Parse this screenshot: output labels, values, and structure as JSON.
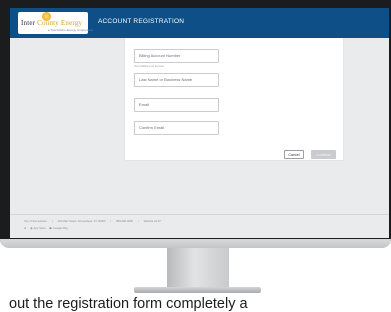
{
  "app": {
    "logo_text_a": "Inter",
    "logo_text_b": "County Energy",
    "logo_tagline": "a Touchstone Energy Cooperative",
    "header_title": "ACCOUNT REGISTRATION"
  },
  "form": {
    "billing_account_placeholder": "Billing Account Number",
    "billing_account_hint": "View bill/find your account",
    "last_name_placeholder": "Last Name or Business Name",
    "email_placeholder": "Email",
    "confirm_email_placeholder": "Confirm Email",
    "cancel_label": "Cancel",
    "continue_label": "Continue"
  },
  "footer": {
    "address_parts": [
      "City of Somewhere",
      "123 Main Street, Somewhere, KY 00000",
      "859-000-0000",
      "Website 24.07"
    ],
    "app_store_label": "App Store",
    "google_play_label": "Google Play"
  },
  "caption": "out the registration form completely a",
  "colors": {
    "header": "#0d4f86",
    "screen_bg": "#eaebec",
    "bezel": "#1b1c1e"
  }
}
